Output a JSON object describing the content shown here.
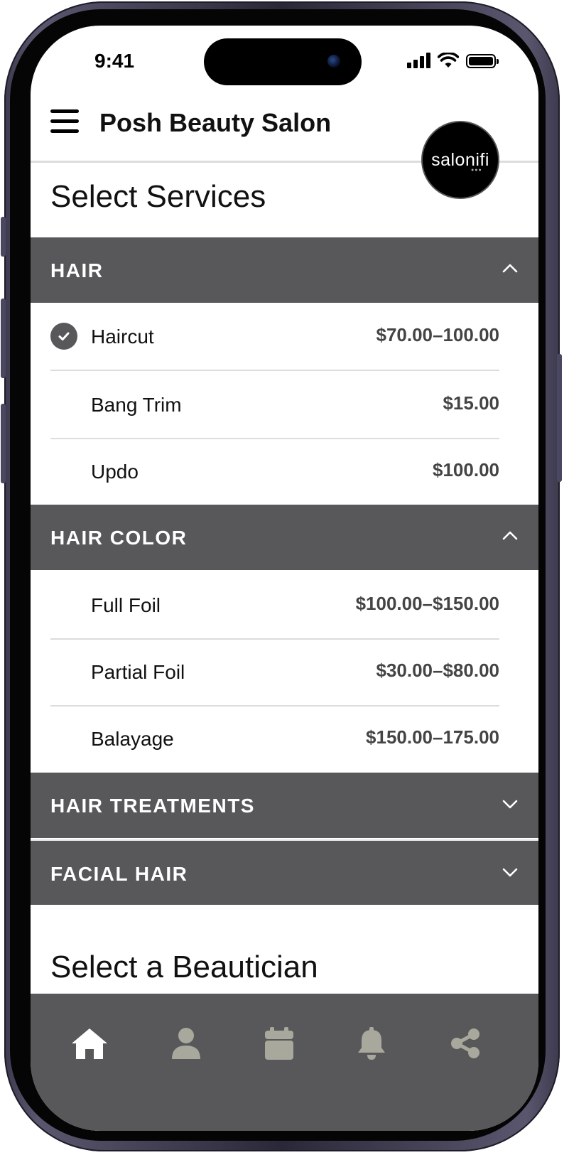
{
  "status_bar": {
    "time": "9:41"
  },
  "header": {
    "salon_name": "Posh Beauty Salon",
    "logo_text": "salonifi",
    "logo_subtext": "●●●"
  },
  "services_title": "Select Services",
  "categories": [
    {
      "label": "HAIR",
      "expanded": true,
      "items": [
        {
          "name": "Haircut",
          "price": "$70.00–100.00",
          "selected": true
        },
        {
          "name": "Bang Trim",
          "price": "$15.00",
          "selected": false
        },
        {
          "name": "Updo",
          "price": "$100.00",
          "selected": false
        }
      ]
    },
    {
      "label": "HAIR COLOR",
      "expanded": true,
      "items": [
        {
          "name": "Full Foil",
          "price": "$100.00–$150.00",
          "selected": false
        },
        {
          "name": "Partial Foil",
          "price": "$30.00–$80.00",
          "selected": false
        },
        {
          "name": "Balayage",
          "price": "$150.00–175.00",
          "selected": false
        }
      ]
    },
    {
      "label": "HAIR TREATMENTS",
      "expanded": false,
      "items": []
    },
    {
      "label": "FACIAL HAIR",
      "expanded": false,
      "items": []
    }
  ],
  "beautician_title": "Select a Beautician",
  "tab_bar": {
    "tabs": [
      {
        "icon": "home-icon",
        "active": true
      },
      {
        "icon": "user-icon",
        "active": false
      },
      {
        "icon": "calendar-icon",
        "active": false
      },
      {
        "icon": "bell-icon",
        "active": false
      },
      {
        "icon": "share-icon",
        "active": false
      }
    ],
    "active_color": "#ffffff",
    "inactive_color": "#a8a89c"
  },
  "colors": {
    "category_bg": "#58585b",
    "divider": "#dcdcdc",
    "price_text": "#444444"
  }
}
